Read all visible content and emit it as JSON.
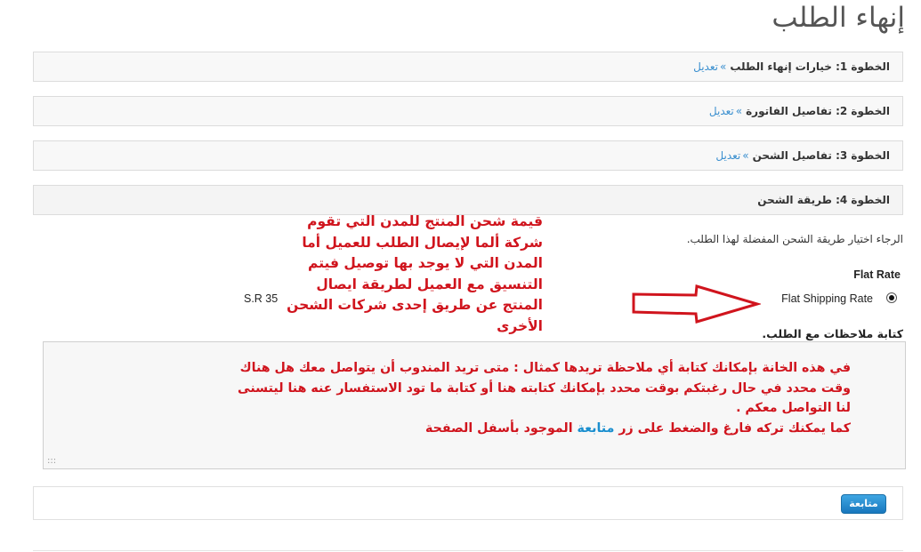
{
  "page": {
    "title": "إنهاء الطلب"
  },
  "steps": [
    {
      "title": "الخطوة 1: خيارات إنهاء الطلب",
      "separator": "»",
      "edit_label": "تعديل"
    },
    {
      "title": "الخطوة 2: تفاصيل الفاتورة",
      "separator": "»",
      "edit_label": "تعديل"
    },
    {
      "title": "الخطوة 3: تفاصيل الشحن",
      "separator": "»",
      "edit_label": "تعديل"
    },
    {
      "title": "الخطوة 4: طريقة الشحن"
    }
  ],
  "shipping": {
    "instruction": "الرجاء اختيار طريقة الشحن المفضلة لهذا الطلب.",
    "method_heading": "Flat Rate",
    "option": {
      "label": "Flat Shipping Rate",
      "price": "S.R 35",
      "selected": true
    }
  },
  "annotations": {
    "shipping_note": "قيمة شحن المنتج للمدن التي تقوم شركة ألما لإيصال الطلب للعميل أما المدن التي لا يوجد بها توصيل فيتم التنسيق مع العميل لطريقة ايصال المنتج عن طريق إحدى شركات الشحن الأخرى",
    "comments_note_main": "في هذه الخانة بإمكانك كتابة أي ملاحظة تريدها كمثال : متى تريد المندوب أن يتواصل معك هل هناك وقت محدد في حال رغبتكم بوقت محدد بإمكانك كتابته هنا أو كتابة ما تود الاستفسار عنه هنا ليتسنى لنا التواصل معكم .",
    "comments_note_tail_start": "كما يمكنك تركه فارغ والضغط على زر",
    "comments_note_highlight": "متابعة",
    "comments_note_tail_end": "الموجود بأسفل الصفحة"
  },
  "comments": {
    "label": "كتابة ملاحظات مع الطلب.",
    "grip": ":::"
  },
  "actions": {
    "continue_label": "متابعة"
  },
  "colors": {
    "accent": "#3a8fcf",
    "annotation": "#d0141d",
    "button": "#1877bd"
  }
}
